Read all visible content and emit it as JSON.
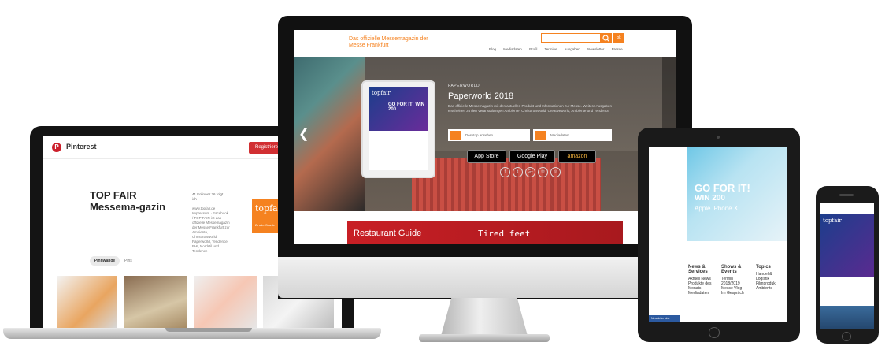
{
  "laptop": {
    "brand": "Pinterest",
    "logo_glyph": "P",
    "register_label": "Registrieren",
    "profile_title": "TOP FAIR Messema-gazin",
    "stats": "41 Follower  26 folgt ich",
    "description": "www.topfair.de · Impressum · Facebook / TOP FAIR ist das offizielle Messemagazin der Messe Frankfurt zur Ambiente, Christmasworld, Paperworld, Tendence, BHI, Nordstil und Tendence",
    "thumb_brand": "topfair",
    "thumb_caption": "Zu allen Boards",
    "tabs": [
      "Pinnwände",
      "Pins"
    ],
    "active_tab": "Pinnwände"
  },
  "desktop": {
    "site_title": "Das offizielle Messemagazin der Messe Frankfurt",
    "search_placeholder": "",
    "search_button": "ok",
    "nav": [
      "Blog",
      "Mediadaten",
      "Profil",
      "Termine",
      "Ausgaben",
      "Newsletter",
      "Presse"
    ],
    "hero": {
      "kicker": "PAPERWORLD",
      "title": "Paperworld 2018",
      "text": "Das offizielle Messemagazin mit den aktuellen Produkt-und Informationen zur Messe. Weitere Ausgaben erscheinen zu den Veranstaltungen Ambiente, Christmasworld, Creativeworld, Ambiente und Tendence",
      "btn_desktop": "Desktop ansehen",
      "btn_mediadaten": "Mediadaten",
      "stores": [
        "App Store",
        "Google Play",
        "amazon"
      ],
      "store_small": [
        "Laden im",
        "JETZT BEI",
        "Erhältlich bei"
      ],
      "social": [
        "f",
        "t",
        "G+",
        "✉",
        "◎"
      ],
      "mag_brand": "topfair",
      "mag_headline": "GO FOR IT! WIN 200"
    },
    "ad": {
      "left": "Restaurant Guide",
      "right": "Tired feet"
    }
  },
  "tablet": {
    "ad_line1": "GO FOR IT!",
    "ad_line2": "WIN 200",
    "ad_line3": "Apple iPhone X",
    "columns": [
      {
        "title": "News & Services",
        "items": [
          "Aktuell News",
          "Produkte des Monats",
          "Mediadaten"
        ]
      },
      {
        "title": "Shows & Events",
        "items": [
          "Termin 2018/2019",
          "Messe Vlog",
          "Im Gespräch"
        ]
      },
      {
        "title": "Topics",
        "items": [
          "Handel & Logistik",
          "Filmproduk",
          "Ambiente"
        ]
      }
    ],
    "blue_bar": "Newsletter abo"
  },
  "phone": {
    "mag_brand": "topfair"
  },
  "colors": {
    "brand_orange": "#f58220",
    "pinterest_red": "#d12f32",
    "ad_red": "#c81f25"
  }
}
